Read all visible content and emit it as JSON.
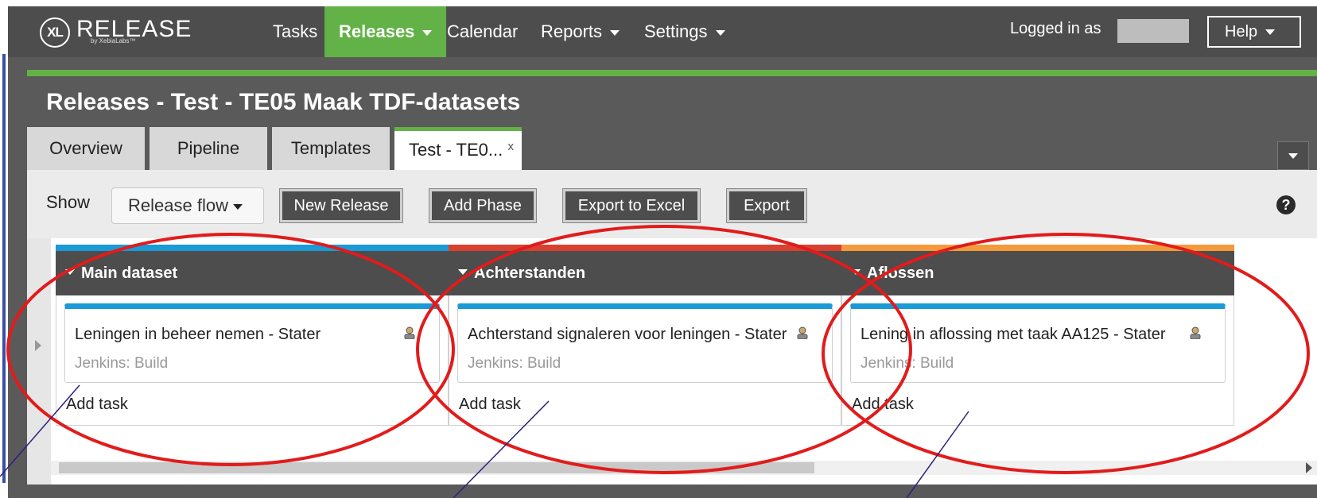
{
  "app": {
    "logo_mark": "XL",
    "logo_text": "RELEASE",
    "logo_sub": "by XebiaLabs™"
  },
  "nav": {
    "items": [
      {
        "label": "Tasks"
      },
      {
        "label": "Releases"
      },
      {
        "label": "Calendar"
      },
      {
        "label": "Reports"
      },
      {
        "label": "Settings"
      }
    ],
    "active": "Releases",
    "login_text": "Logged in as",
    "help_label": "Help"
  },
  "page": {
    "title": "Releases - Test - TE05 Maak TDF-datasets"
  },
  "tabs": [
    {
      "label": "Overview"
    },
    {
      "label": "Pipeline"
    },
    {
      "label": "Templates"
    },
    {
      "label": "Test - TE0..."
    }
  ],
  "tab_close": "x",
  "toolbar": {
    "show_label": "Show",
    "view_select": "Release flow",
    "buttons": [
      "New Release",
      "Add Phase",
      "Export to Excel",
      "Export"
    ],
    "help_symbol": "?"
  },
  "phases": [
    {
      "name": "Main dataset",
      "color": "#1a9ad6",
      "task": {
        "title": "Leningen in beheer nemen - Stater",
        "subtitle": "Jenkins: Build"
      },
      "add_task": "Add task"
    },
    {
      "name": "Achterstanden",
      "color": "#d8412f",
      "task": {
        "title": "Achterstand signaleren voor leningen - Stater",
        "subtitle": "Jenkins: Build"
      },
      "add_task": "Add task"
    },
    {
      "name": "Aflossen",
      "color": "#f49a3c",
      "task": {
        "title": "Lening in aflossing met taak AA125 - Stater",
        "subtitle": "Jenkins: Build"
      },
      "add_task": "Add task"
    }
  ],
  "colors": {
    "accent_green": "#62b247",
    "nav_dark": "#4d4d4d",
    "annotation_red": "#e21b1b",
    "annotation_line": "#2a2080"
  }
}
